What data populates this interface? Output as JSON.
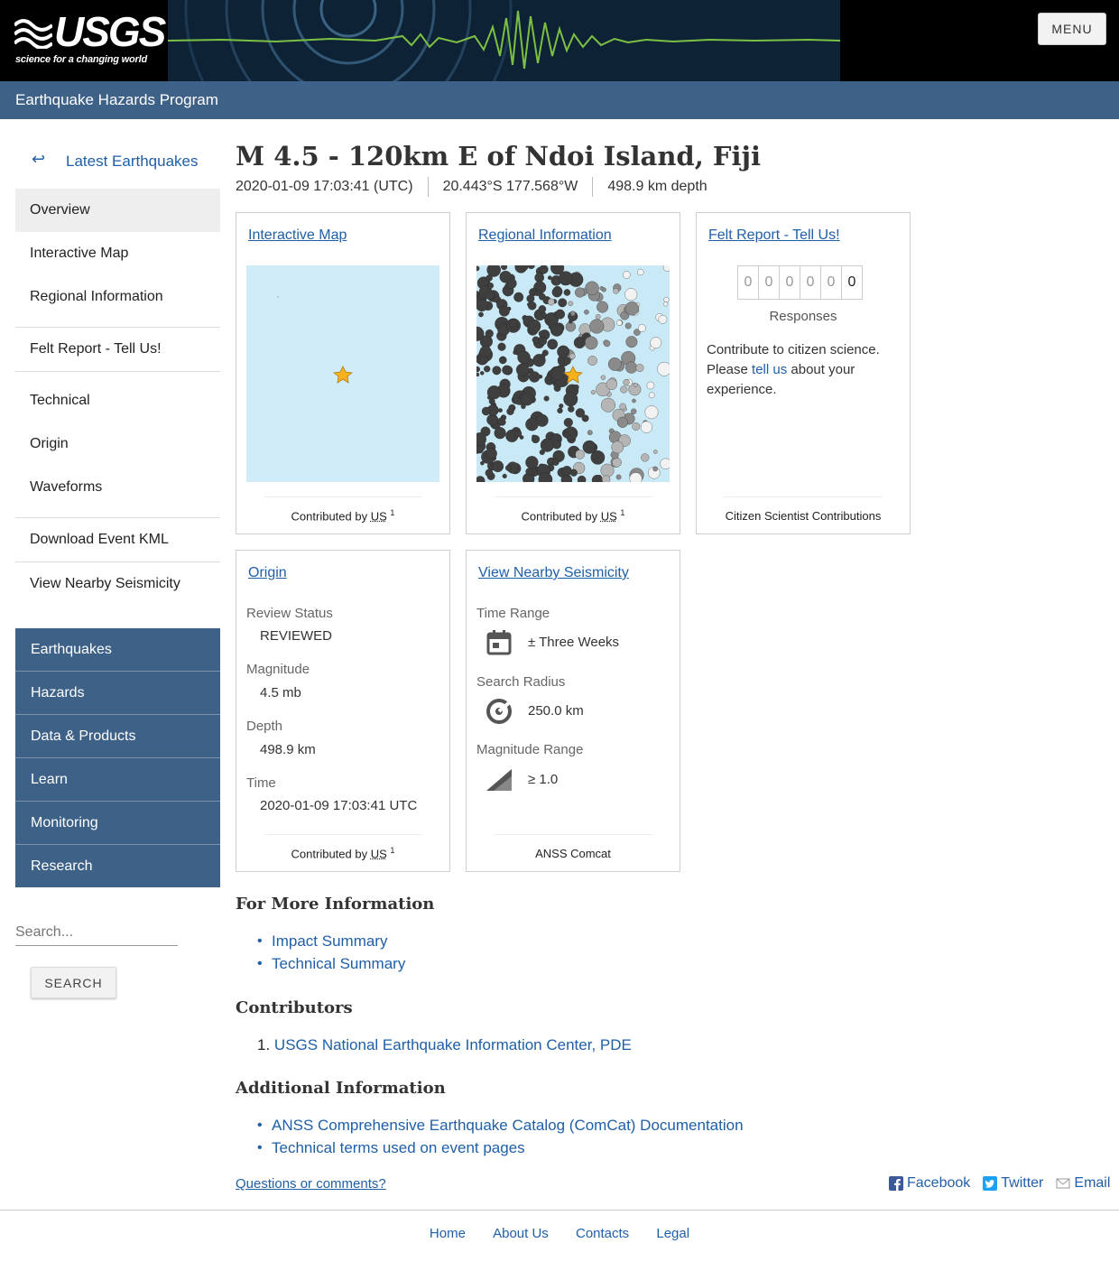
{
  "header": {
    "logo_text": "USGS",
    "logo_tagline": "science for a changing world",
    "menu_label": "MENU",
    "site_name": "Earthquake Hazards Program"
  },
  "sidebar": {
    "back_label": "Latest Earthquakes",
    "back_arrow": "↩",
    "items": [
      {
        "label": "Overview",
        "active": true
      },
      {
        "label": "Interactive Map"
      },
      {
        "label": "Regional Information"
      },
      {
        "label": "Felt Report - Tell Us!"
      },
      {
        "label": "Technical"
      },
      {
        "label": "Origin"
      },
      {
        "label": "Waveforms"
      },
      {
        "label": "Download Event KML"
      },
      {
        "label": "View Nearby Seismicity"
      }
    ],
    "sections": [
      {
        "label": "Earthquakes"
      },
      {
        "label": "Hazards"
      },
      {
        "label": "Data & Products"
      },
      {
        "label": "Learn"
      },
      {
        "label": "Monitoring"
      },
      {
        "label": "Research"
      }
    ],
    "search_placeholder": "Search...",
    "search_button": "SEARCH"
  },
  "event": {
    "title": "M 4.5 - 120km E of Ndoi Island, Fiji",
    "time": "2020-01-09 17:03:41 (UTC)",
    "location": "20.443°S 177.568°W",
    "depth": "498.9 km depth"
  },
  "cards": {
    "contrib_prefix": "Contributed by",
    "contrib_net": "US",
    "contrib_sup": "1",
    "map": {
      "title": "Interactive Map"
    },
    "regional": {
      "title": "Regional Information"
    },
    "felt": {
      "title": "Felt Report - Tell Us!",
      "digits": [
        "0",
        "0",
        "0",
        "0",
        "0",
        "0"
      ],
      "responses_label": "Responses",
      "text_before": "Contribute to citizen science. Please",
      "link_text": "tell us",
      "text_after": "about your experience.",
      "footer": "Citizen Scientist Contributions"
    },
    "origin": {
      "title": "Origin",
      "fields": [
        {
          "label": "Review Status",
          "value": "REVIEWED"
        },
        {
          "label": "Magnitude",
          "value": "4.5 mb"
        },
        {
          "label": "Depth",
          "value": "498.9 km"
        },
        {
          "label": "Time",
          "value": "2020-01-09 17:03:41 UTC"
        }
      ]
    },
    "seismicity": {
      "title": "View Nearby Seismicity",
      "fields": [
        {
          "label": "Time Range",
          "value": "± Three Weeks",
          "icon": "calendar-icon"
        },
        {
          "label": "Search Radius",
          "value": "250.0 km",
          "icon": "radius-target-icon"
        },
        {
          "label": "Magnitude Range",
          "value": "≥ 1.0",
          "icon": "magnitude-ramp-icon"
        }
      ],
      "footer": "ANSS Comcat"
    }
  },
  "more_info": {
    "heading": "For More Information",
    "links": [
      "Impact Summary",
      "Technical Summary"
    ]
  },
  "contributors": {
    "heading": "Contributors",
    "items": [
      {
        "num": "1.",
        "label": "USGS National Earthquake Information Center, PDE"
      }
    ]
  },
  "additional": {
    "heading": "Additional Information",
    "links": [
      "ANSS Comprehensive Earthquake Catalog (ComCat) Documentation",
      "Technical terms used on event pages"
    ]
  },
  "bottom": {
    "questions": "Questions or comments?",
    "social": [
      "Facebook",
      "Twitter",
      "Email"
    ]
  },
  "footer": {
    "links": [
      "Home",
      "About Us",
      "Contacts",
      "Legal"
    ]
  },
  "colors": {
    "nav_blue": "#3e6188",
    "link_blue": "#1f5fa8",
    "ocean": "#c9e9f6"
  }
}
